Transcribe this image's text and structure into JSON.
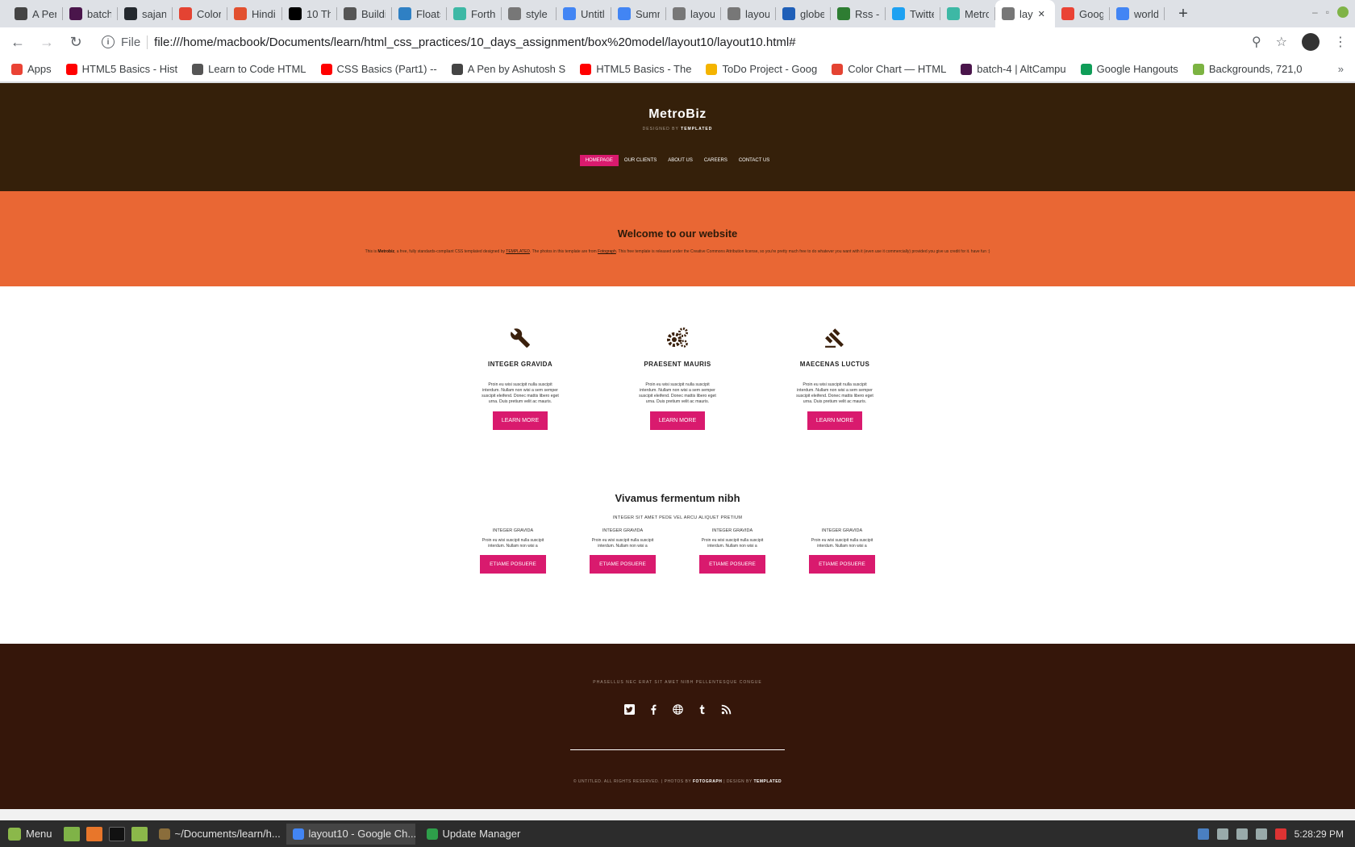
{
  "browser": {
    "tabs": [
      {
        "title": "A Pen",
        "color": "#444444",
        "icon": "codepen-icon"
      },
      {
        "title": "batch",
        "color": "#4a154b",
        "icon": "slack-icon"
      },
      {
        "title": "sajan",
        "color": "#24292e",
        "icon": "github-icon"
      },
      {
        "title": "Color",
        "color": "#e44332",
        "icon": "color-icon"
      },
      {
        "title": "Hindi",
        "color": "#e2502f",
        "icon": "g-icon"
      },
      {
        "title": "10 Th",
        "color": "#000000",
        "icon": "medium-icon"
      },
      {
        "title": "Buildi",
        "color": "#555555",
        "icon": "code-icon"
      },
      {
        "title": "Floats",
        "color": "#2f80c4",
        "icon": "floats-icon"
      },
      {
        "title": "Forthi",
        "color": "#3db8a5",
        "icon": "templated-icon"
      },
      {
        "title": "style",
        "color": "#777777",
        "icon": "file-icon"
      },
      {
        "title": "Untitl",
        "color": "#4285f4",
        "icon": "docs-icon"
      },
      {
        "title": "Summ",
        "color": "#4285f4",
        "icon": "docs-icon"
      },
      {
        "title": "layou",
        "color": "#777777",
        "icon": "file-icon"
      },
      {
        "title": "layou",
        "color": "#777777",
        "icon": "file-icon"
      },
      {
        "title": "globe",
        "color": "#1f5fb8",
        "icon": "flag-icon"
      },
      {
        "title": "Rss -",
        "color": "#2e7d32",
        "icon": "rss-icon"
      },
      {
        "title": "Twitte",
        "color": "#1da1f2",
        "icon": "twitter-icon"
      },
      {
        "title": "Metro",
        "color": "#3db8a5",
        "icon": "templated-icon"
      },
      {
        "title": "lay",
        "color": "#777777",
        "icon": "file-icon",
        "active": true
      },
      {
        "title": "Goog",
        "color": "#ea4335",
        "icon": "f-icon"
      },
      {
        "title": "world",
        "color": "#4285f4",
        "icon": "google-icon"
      }
    ],
    "address": {
      "scheme": "File",
      "url": "file:///home/macbook/Documents/learn/html_css_practices/10_days_assignment/box%20model/layout10/layout10.html#"
    },
    "bookmarks": [
      {
        "title": "Apps",
        "color": "#ea4335"
      },
      {
        "title": "HTML5 Basics - Hist",
        "color": "#ff0000"
      },
      {
        "title": "Learn to Code HTML",
        "color": "#555555"
      },
      {
        "title": "CSS Basics (Part1) --",
        "color": "#ff0000"
      },
      {
        "title": "A Pen by Ashutosh S",
        "color": "#444444"
      },
      {
        "title": "HTML5 Basics - The",
        "color": "#ff0000"
      },
      {
        "title": "ToDo Project - Goog",
        "color": "#f4b400"
      },
      {
        "title": "Color Chart — HTML",
        "color": "#e44332"
      },
      {
        "title": "batch-4 | AltCampu",
        "color": "#4a154b"
      },
      {
        "title": "Google Hangouts",
        "color": "#0f9d58"
      },
      {
        "title": "Backgrounds, 721,0",
        "color": "#7cb342"
      }
    ],
    "more_label": "»"
  },
  "site": {
    "logo": "MetroBiz",
    "tagline_prefix": "DESIGNED BY",
    "tagline_brand": "TEMPLATED",
    "nav": [
      "HOMEPAGE",
      "OUR CLIENTS",
      "ABOUT US",
      "CAREERS",
      "CONTACT US"
    ],
    "welcome": {
      "title": "Welcome to our website",
      "text_1": "This is ",
      "brand": "Metrobiz",
      "text_2": ", a free, fully standards-compliant CSS templated designed by ",
      "link_1": "TEMPLATED",
      "text_3": ". The photos in this template are from ",
      "link_2": "Fotograph",
      "text_4": ". This free template is released under the Creative Commons Attribution license, so you're pretty much free to do whatever you want with it (even use it commercially) provided you give us credit for it. have fun :)"
    },
    "features": [
      {
        "icon": "wrench-icon",
        "title": "INTEGER GRAVIDA",
        "text": "Proin eu wisi suscipit nulla suscipit interdum. Nullam non wisi a sem semper suscipit eleifend. Donec mattis libero eget urna. Duis pretium velit ac mauris.",
        "button": "LEARN MORE"
      },
      {
        "icon": "gears-icon",
        "title": "PRAESENT MAURIS",
        "text": "Proin eu wisi suscipit nulla suscipit interdum. Nullam non wisi a sem semper suscipit eleifend. Donec mattis libero eget urna. Duis pretium velit ac mauris.",
        "button": "LEARN MORE"
      },
      {
        "icon": "gavel-icon",
        "title": "MAECENAS LUCTUS",
        "text": "Proin eu wisi suscipit nulla suscipit interdum. Nullam non wisi a sem semper suscipit eleifend. Donec mattis libero eget urna. Duis pretium velit ac mauris.",
        "button": "LEARN MORE"
      }
    ],
    "vivamus": {
      "title": "Vivamus fermentum nibh",
      "subtitle": "INTEGER SIT AMET PEDE VEL ARCU ALIQUET PRETIUM",
      "columns": [
        {
          "title": "INTEGER GRAVIDA",
          "text": "Proin eu wisi suscipit nulla suscipit interdum. Nullam non wisi a",
          "button": "ETIAME POSUERE"
        },
        {
          "title": "INTEGER GRAVIDA",
          "text": "Proin eu wisi suscipit nulla suscipit interdum. Nullam non wisi a",
          "button": "ETIAME POSUERE"
        },
        {
          "title": "INTEGER GRAVIDA",
          "text": "Proin eu wisi suscipit nulla suscipit interdum. Nullam non wisi a",
          "button": "ETIAME POSUERE"
        },
        {
          "title": "INTEGER GRAVIDA",
          "text": "Proin eu wisi suscipit nulla suscipit interdum. Nullam non wisi a",
          "button": "ETIAME POSUERE"
        }
      ]
    },
    "footer": {
      "tagline": "PHASELLUS NEC ERAT SIT AMET NIBH PELLENTESQUE CONGUE",
      "social": [
        "twitter-icon",
        "facebook-icon",
        "globe-icon",
        "tumblr-icon",
        "rss-icon"
      ],
      "copy_1": "© UNTITLED. ALL RIGHTS RESERVED. | PHOTOS BY ",
      "copy_brand_1": "FOTOGRAPH",
      "copy_2": " | DESIGN BY ",
      "copy_brand_2": "TEMPLATED"
    }
  },
  "taskbar": {
    "menu_label": "Menu",
    "tasks": [
      {
        "title": "~/Documents/learn/h...",
        "color": "#8a6d3b"
      },
      {
        "title": "layout10 - Google Ch...",
        "color": "#4285f4",
        "active": true
      },
      {
        "title": "Update Manager",
        "color": "#2e9f4a"
      }
    ],
    "clock": "5:28:29 PM"
  },
  "colors": {
    "header_bg": "#35200a",
    "accent": "#d91a6e",
    "welcome_bg": "#e96734",
    "footer_bg": "#35160a"
  }
}
